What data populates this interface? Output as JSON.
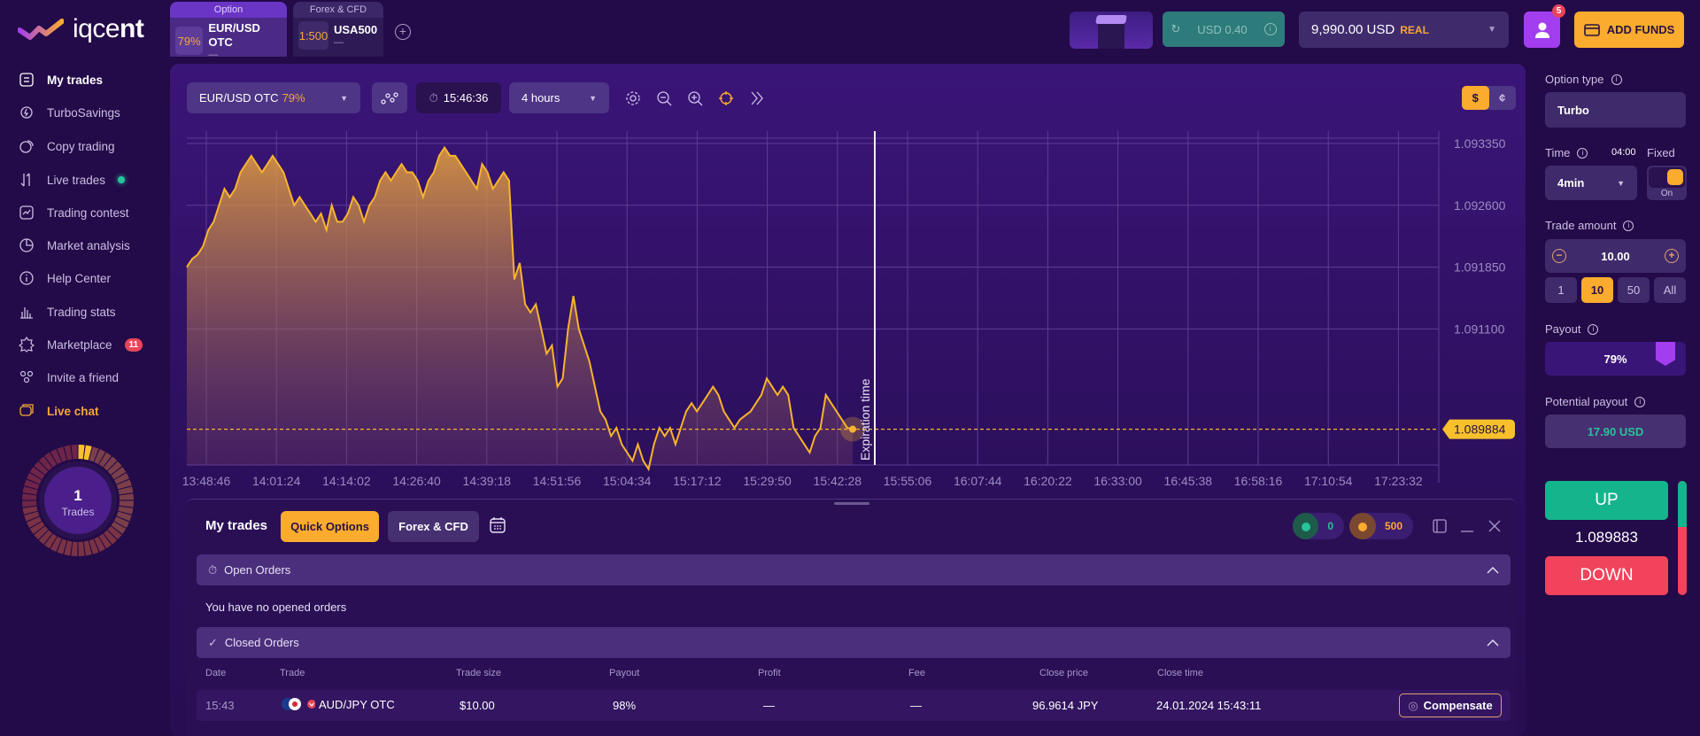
{
  "brand": {
    "name_light": "iqce",
    "name_bold": "nt"
  },
  "asset_tabs": [
    {
      "category": "Option",
      "badge": "79%",
      "name": "EUR/USD OTC",
      "sub": "—"
    },
    {
      "category": "Forex & CFD",
      "badge": "1:500",
      "name": "USA500",
      "sub": "—"
    }
  ],
  "header": {
    "cashback": "USD 0.40",
    "balance": "9,990.00 USD",
    "account_type": "REAL",
    "notifications": "5",
    "add_funds": "ADD FUNDS"
  },
  "sidebar": {
    "items": [
      {
        "label": "My trades",
        "icon": "trades-icon"
      },
      {
        "label": "TurboSavings",
        "icon": "turbo-savings-icon"
      },
      {
        "label": "Copy trading",
        "icon": "copy-trading-icon"
      },
      {
        "label": "Live trades",
        "icon": "live-trades-icon"
      },
      {
        "label": "Trading contest",
        "icon": "contest-icon"
      },
      {
        "label": "Market analysis",
        "icon": "pie-chart-icon"
      },
      {
        "label": "Help Center",
        "icon": "info-icon"
      },
      {
        "label": "Trading stats",
        "icon": "bar-chart-icon"
      },
      {
        "label": "Marketplace",
        "icon": "marketplace-icon",
        "badge": "11"
      },
      {
        "label": "Invite a friend",
        "icon": "users-icon"
      },
      {
        "label": "Live chat",
        "icon": "chat-icon"
      }
    ],
    "trades_count": "1",
    "trades_label": "Trades"
  },
  "chart_toolbar": {
    "asset": "EUR/USD OTC",
    "asset_payout": "79%",
    "clock": "15:46:36",
    "interval": "4 hours",
    "currency_on": "$",
    "currency_off": "¢"
  },
  "chart_data": {
    "type": "area",
    "title": "EUR/USD OTC",
    "xlabel": "",
    "ylabel": "",
    "x_ticks": [
      "13:48:46",
      "14:01:24",
      "14:14:02",
      "14:26:40",
      "14:39:18",
      "14:51:56",
      "15:04:34",
      "15:17:12",
      "15:29:50",
      "15:42:28",
      "15:55:06",
      "16:07:44",
      "16:20:22",
      "16:33:00",
      "16:45:38",
      "16:58:16",
      "17:10:54",
      "17:23:32"
    ],
    "y_ticks": [
      1.09335,
      1.0926,
      1.09185,
      1.0911
    ],
    "y_tick_labels": [
      "1.093350",
      "1.092600",
      "1.091850",
      "1.091100"
    ],
    "ylim": [
      1.08945,
      1.0935
    ],
    "current_price": 1.089884,
    "current_price_label": "1.089884",
    "expiration_label": "Expiration time",
    "expiration_time": "15:50:36",
    "series": [
      {
        "name": "EUR/USD OTC",
        "x_minutes": [
          0,
          1,
          2,
          3,
          4,
          5,
          6,
          7,
          8,
          9,
          10,
          11,
          12,
          13,
          14,
          15,
          16,
          17,
          18,
          19,
          20,
          21,
          22,
          23,
          24,
          25,
          26,
          27,
          28,
          29,
          30,
          31,
          32,
          33,
          34,
          35,
          36,
          37,
          38,
          39,
          40,
          41,
          42,
          43,
          44,
          45,
          46,
          47,
          48,
          49,
          50,
          51,
          52,
          53,
          54,
          55,
          56,
          57,
          58,
          59,
          60,
          61,
          62,
          63,
          64,
          65,
          66,
          67,
          68,
          69,
          70,
          71,
          72,
          73,
          74,
          75,
          76,
          77,
          78,
          79,
          80,
          81,
          82,
          83,
          84,
          85,
          86,
          87,
          88,
          89,
          90,
          91,
          92,
          93,
          94,
          95,
          96,
          97,
          98,
          99,
          100,
          101,
          102,
          103,
          104,
          105,
          106,
          107,
          108,
          109,
          110,
          111,
          112,
          113,
          114,
          115,
          116,
          117,
          118,
          119,
          120,
          121,
          122,
          123,
          124,
          125,
          126,
          127,
          128,
          129,
          130,
          131,
          132,
          133,
          134,
          135,
          136,
          137,
          138,
          139,
          140,
          141,
          142,
          143,
          144,
          145,
          146,
          147,
          148,
          149,
          150,
          151,
          152,
          153,
          154,
          155,
          156,
          157,
          158,
          159,
          160,
          161,
          162,
          163,
          164,
          165,
          166,
          167,
          168,
          169,
          170,
          171,
          172,
          173,
          174,
          175,
          176,
          177,
          178,
          179,
          180,
          181,
          182,
          183,
          184
        ],
        "values": [
          1.09185,
          1.09195,
          1.092,
          1.0921,
          1.0923,
          1.0924,
          1.0926,
          1.0928,
          1.0927,
          1.0928,
          1.093,
          1.0931,
          1.0932,
          1.0931,
          1.093,
          1.0931,
          1.0932,
          1.0931,
          1.093,
          1.0928,
          1.0926,
          1.0927,
          1.0926,
          1.0925,
          1.0924,
          1.0925,
          1.0923,
          1.0926,
          1.0924,
          1.0924,
          1.0925,
          1.0927,
          1.0926,
          1.0924,
          1.0926,
          1.0927,
          1.0929,
          1.093,
          1.0929,
          1.093,
          1.0931,
          1.093,
          1.093,
          1.0929,
          1.0927,
          1.0929,
          1.093,
          1.0932,
          1.0933,
          1.0932,
          1.0932,
          1.0931,
          1.093,
          1.0929,
          1.0928,
          1.0931,
          1.093,
          1.0928,
          1.0929,
          1.093,
          1.0929,
          1.0917,
          1.0919,
          1.0914,
          1.0913,
          1.0914,
          1.0911,
          1.0908,
          1.0909,
          1.0904,
          1.0905,
          1.0911,
          1.0915,
          1.0911,
          1.0909,
          1.0907,
          1.0904,
          1.0901,
          1.09,
          1.0898,
          1.0899,
          1.0897,
          1.0896,
          1.0895,
          1.0897,
          1.0895,
          1.0894,
          1.0897,
          1.0899,
          1.0898,
          1.0899,
          1.0897,
          1.0899,
          1.0901,
          1.0902,
          1.0901,
          1.0902,
          1.0903,
          1.0904,
          1.0903,
          1.0901,
          1.09,
          1.0899,
          1.09,
          1.09005,
          1.0901,
          1.0902,
          1.0903,
          1.0905,
          1.0904,
          1.0903,
          1.0904,
          1.0903,
          1.0899,
          1.0898,
          1.0897,
          1.0896,
          1.0898,
          1.0899,
          1.0903,
          1.0902,
          1.0901,
          1.09,
          1.0899,
          1.089884
        ],
        "color": "#f8b42c"
      }
    ]
  },
  "trades_panel": {
    "title": "My trades",
    "tab_quick": "Quick Options",
    "tab_forex": "Forex & CFD",
    "coin_green": "0",
    "coin_orange": "500",
    "open_orders": "Open Orders",
    "no_orders": "You have no opened orders",
    "closed_orders": "Closed Orders",
    "columns": [
      "Date",
      "Trade",
      "Trade size",
      "Payout",
      "Profit",
      "Fee",
      "Close price",
      "Close time"
    ],
    "rows": [
      {
        "date": "15:43",
        "trade": "AUD/JPY OTC",
        "direction": "down",
        "size": "$10.00",
        "payout": "98%",
        "profit": "—",
        "fee": "—",
        "close_price": "96.9614 JPY",
        "close_time": "24.01.2024 15:43:11",
        "action": "Compensate"
      }
    ]
  },
  "order_panel": {
    "option_type_label": "Option type",
    "option_type": "Turbo",
    "time_label": "Time",
    "time_countdown": "04:00",
    "fixed_label": "Fixed",
    "time_value": "4min",
    "fixed_state": "On",
    "amount_label": "Trade amount",
    "amount": "10.00",
    "quick_amounts": [
      "1",
      "10",
      "50",
      "All"
    ],
    "quick_selected": "10",
    "payout_label": "Payout",
    "payout": "79%",
    "potential_label": "Potential payout",
    "potential": "17.90 USD",
    "up": "UP",
    "price": "1.089883",
    "down": "DOWN",
    "sentiment_up_pct": 40
  },
  "colors": {
    "accent": "#fbab2e",
    "up": "#14b48c",
    "down": "#f2435c",
    "brand": "#a33df0",
    "line": "#f8b42c"
  }
}
